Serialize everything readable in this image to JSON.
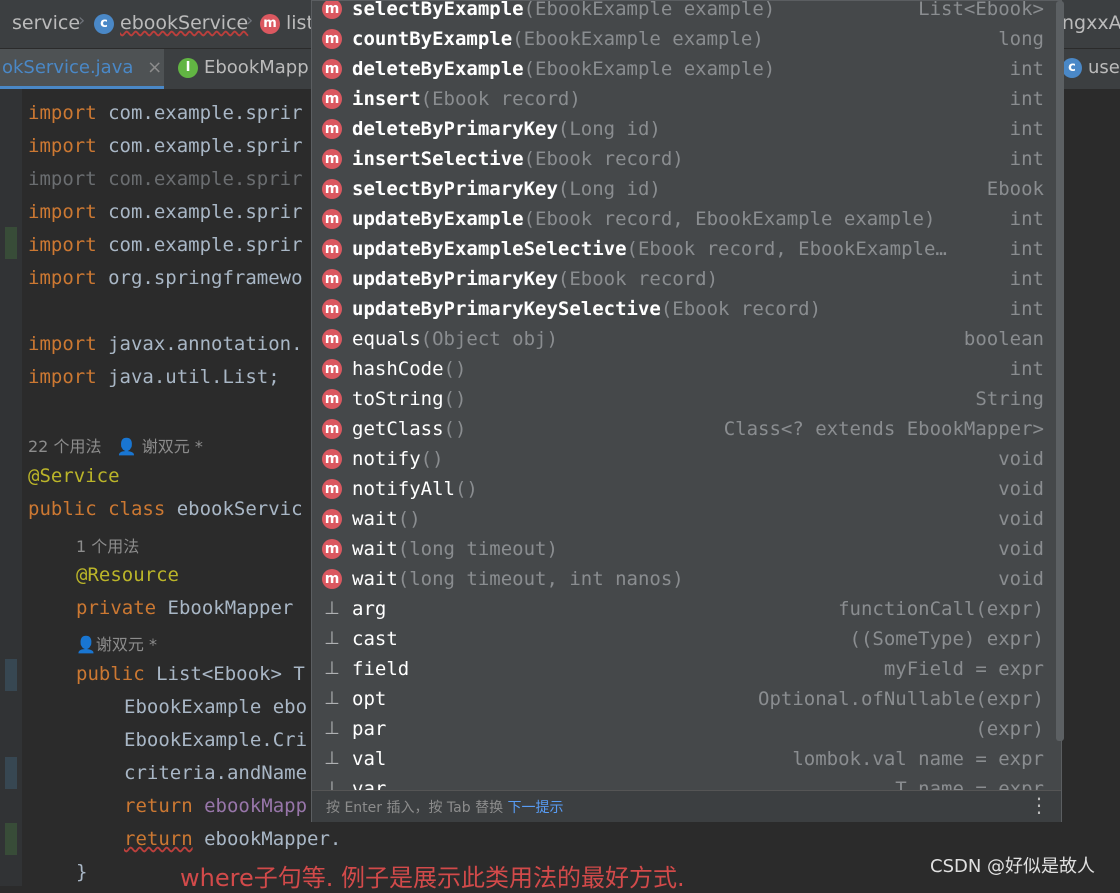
{
  "breadcrumb": {
    "items": [
      "service",
      "ebookService",
      "list"
    ],
    "right_text": "ngxxAp"
  },
  "tabs": [
    {
      "label": "okService.java",
      "close": "×"
    },
    {
      "label": "EbookMapp"
    },
    {
      "label": "user"
    }
  ],
  "editor": {
    "imports": [
      {
        "kw": "import",
        "rest": "com.example.sprir"
      },
      {
        "kw": "import",
        "rest": "com.example.sprir"
      },
      {
        "kw": "import",
        "rest": "com.example.sprir"
      },
      {
        "kw": "import",
        "rest": "com.example.sprir"
      },
      {
        "kw": "import",
        "rest": "com.example.sprir"
      },
      {
        "kw": "import",
        "rest": "org.springframewo"
      },
      {
        "kw": "import",
        "rest": "javax.annotation."
      },
      {
        "kw": "import",
        "rest": "java.util.List;"
      }
    ],
    "usage_class": "22 个用法",
    "author_class": "谢双元 *",
    "service_annotation": "@Service",
    "class_decl_kw": "public class",
    "class_decl_name": "ebookServic",
    "usage_field": "1 个用法",
    "resource_annotation": "@Resource",
    "field_kw": "private",
    "field_rest": "EbookMapper",
    "author_method": "谢双元 *",
    "method_kw": "public",
    "method_rest": "List<Ebook> T",
    "line_example": "EbookExample ebo",
    "line_criteria_type": "EbookExample.Cri",
    "line_criteria_call": "criteria.andName",
    "return_kw": "return",
    "return1_rest": "ebookMapp",
    "return2_rest": "ebookMapper."
  },
  "completion": {
    "items": [
      {
        "icon": "m",
        "name": "selectByExample",
        "params": "(EbookExample example)",
        "type": "List<Ebook>",
        "bold": true
      },
      {
        "icon": "m",
        "name": "countByExample",
        "params": "(EbookExample example)",
        "type": "long",
        "bold": true
      },
      {
        "icon": "m",
        "name": "deleteByExample",
        "params": "(EbookExample example)",
        "type": "int",
        "bold": true
      },
      {
        "icon": "m",
        "name": "insert",
        "params": "(Ebook record)",
        "type": "int",
        "bold": true
      },
      {
        "icon": "m",
        "name": "deleteByPrimaryKey",
        "params": "(Long id)",
        "type": "int",
        "bold": true
      },
      {
        "icon": "m",
        "name": "insertSelective",
        "params": "(Ebook record)",
        "type": "int",
        "bold": true
      },
      {
        "icon": "m",
        "name": "selectByPrimaryKey",
        "params": "(Long id)",
        "type": "Ebook",
        "bold": true
      },
      {
        "icon": "m",
        "name": "updateByExample",
        "params": "(Ebook record, EbookExample example)",
        "type": "int",
        "bold": true
      },
      {
        "icon": "m",
        "name": "updateByExampleSelective",
        "params": "(Ebook record, EbookExample…",
        "type": "int",
        "bold": true
      },
      {
        "icon": "m",
        "name": "updateByPrimaryKey",
        "params": "(Ebook record)",
        "type": "int",
        "bold": true
      },
      {
        "icon": "m",
        "name": "updateByPrimaryKeySelective",
        "params": "(Ebook record)",
        "type": "int",
        "bold": true
      },
      {
        "icon": "m",
        "name": "equals",
        "params": "(Object obj)",
        "type": "boolean",
        "bold": false
      },
      {
        "icon": "m",
        "name": "hashCode",
        "params": "()",
        "type": "int",
        "bold": false
      },
      {
        "icon": "m",
        "name": "toString",
        "params": "()",
        "type": "String",
        "bold": false
      },
      {
        "icon": "m",
        "name": "getClass",
        "params": "()",
        "type": "Class<? extends EbookMapper>",
        "bold": false
      },
      {
        "icon": "m",
        "name": "notify",
        "params": "()",
        "type": "void",
        "bold": false
      },
      {
        "icon": "m",
        "name": "notifyAll",
        "params": "()",
        "type": "void",
        "bold": false
      },
      {
        "icon": "m",
        "name": "wait",
        "params": "()",
        "type": "void",
        "bold": false
      },
      {
        "icon": "m",
        "name": "wait",
        "params": "(long timeout)",
        "type": "void",
        "bold": false
      },
      {
        "icon": "m",
        "name": "wait",
        "params": "(long timeout, int nanos)",
        "type": "void",
        "bold": false
      },
      {
        "icon": "tpl",
        "name": "arg",
        "params": "",
        "type": "functionCall(expr)",
        "bold": false
      },
      {
        "icon": "tpl",
        "name": "cast",
        "params": "",
        "type": "((SomeType) expr)",
        "bold": false
      },
      {
        "icon": "tpl",
        "name": "field",
        "params": "",
        "type": "myField = expr",
        "bold": false
      },
      {
        "icon": "tpl",
        "name": "opt",
        "params": "",
        "type": "Optional.ofNullable(expr)",
        "bold": false
      },
      {
        "icon": "tpl",
        "name": "par",
        "params": "",
        "type": "(expr)",
        "bold": false
      },
      {
        "icon": "tpl",
        "name": "val",
        "params": "",
        "type": "lombok.val name = expr",
        "bold": false
      },
      {
        "icon": "tpl",
        "name": "var",
        "params": "",
        "type": "T name = expr",
        "bold": false
      }
    ],
    "footer_text": "按 Enter 插入，按 Tab 替换",
    "footer_link": "下一提示",
    "kebab": "⋮"
  },
  "overlay": {
    "bottom_text": "where子句等. 例子是展示此类用法的最好方式.",
    "watermark": "CSDN @好似是故人"
  },
  "colors": {
    "method_icon": "#db5860",
    "keyword": "#cc7832",
    "annotation": "#bbb529",
    "link": "#589df6"
  }
}
